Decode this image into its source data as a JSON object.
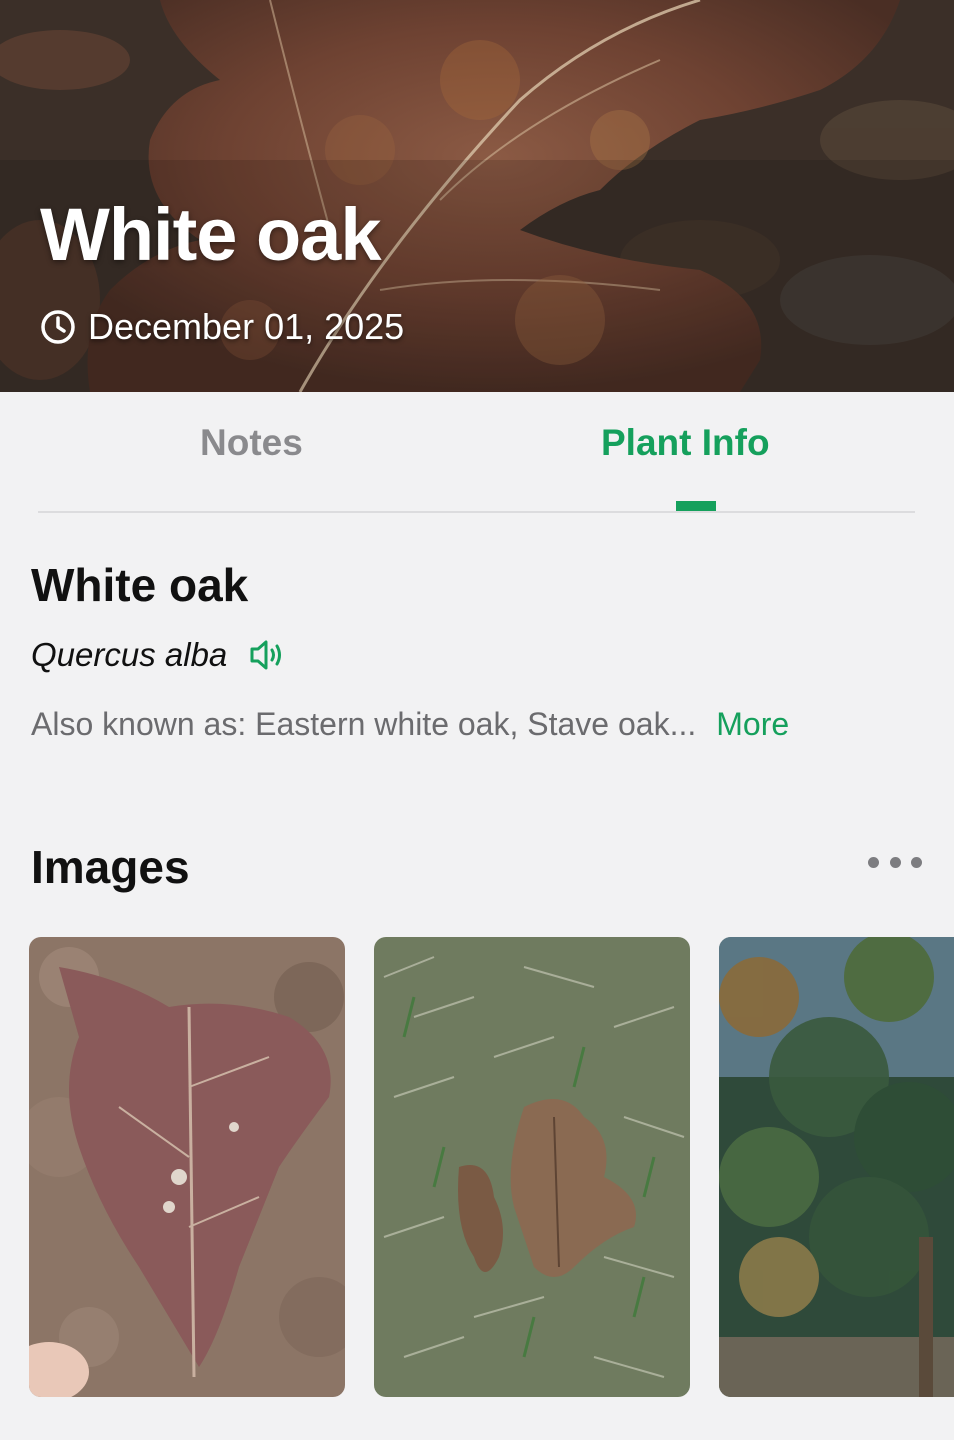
{
  "hero": {
    "title": "White oak",
    "date": "December 01, 2025",
    "date_icon": "clock-icon"
  },
  "tabs": [
    {
      "label": "Notes",
      "active": false
    },
    {
      "label": "Plant Info",
      "active": true
    }
  ],
  "plant": {
    "common_name": "White oak",
    "scientific_name": "Quercus alba",
    "pronounce_icon": "speaker-icon",
    "also_known_as": "Also known as: Eastern white oak, Stave oak...",
    "more_label": "More"
  },
  "images": {
    "heading": "Images",
    "menu_icon": "more-horizontal-icon",
    "items": [
      {
        "name": "image-thumb-leaf-in-hand"
      },
      {
        "name": "image-thumb-leaves-on-grass"
      },
      {
        "name": "image-thumb-tree-canopy"
      }
    ]
  },
  "colors": {
    "accent": "#15a05c",
    "background": "#f2f2f3",
    "inactive_tab": "#8a8a8d",
    "secondary_text": "#6b6b6e"
  }
}
